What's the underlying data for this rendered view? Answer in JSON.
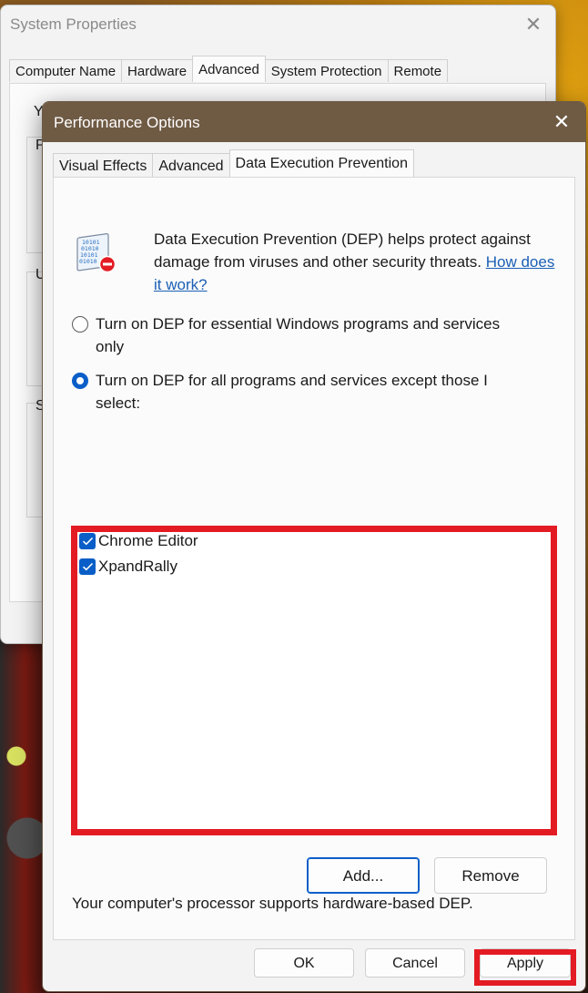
{
  "system_properties": {
    "title": "System Properties",
    "close": "✕",
    "tabs": [
      "Computer Name",
      "Hardware",
      "Advanced",
      "System Protection",
      "Remote"
    ],
    "active_tab": "Advanced",
    "clipped_labels": [
      "Y",
      "P",
      "U",
      "S"
    ]
  },
  "performance_options": {
    "title": "Performance Options",
    "close": "✕",
    "tabs": [
      "Visual Effects",
      "Advanced",
      "Data Execution Prevention"
    ],
    "active_tab": "Data Execution Prevention",
    "description": "Data Execution Prevention (DEP) helps protect against damage from viruses and other security threats.",
    "how_link": "How does it work?",
    "radio_options": [
      {
        "label": "Turn on DEP for essential Windows programs and services only",
        "selected": false
      },
      {
        "label": "Turn on DEP for all programs and services except those I select:",
        "selected": true
      }
    ],
    "programs": [
      {
        "label": "Chrome Editor",
        "checked": true
      },
      {
        "label": "XpandRally",
        "checked": true
      }
    ],
    "add_button": "Add...",
    "remove_button": "Remove",
    "status_text": "Your computer's processor supports hardware-based DEP.",
    "ok_button": "OK",
    "cancel_button": "Cancel",
    "apply_button": "Apply",
    "icon": "dep-binary-document-icon",
    "highlight_color": "#e31b23",
    "accent_color": "#0a5ec8",
    "titlebar_color": "#6f5a44"
  }
}
